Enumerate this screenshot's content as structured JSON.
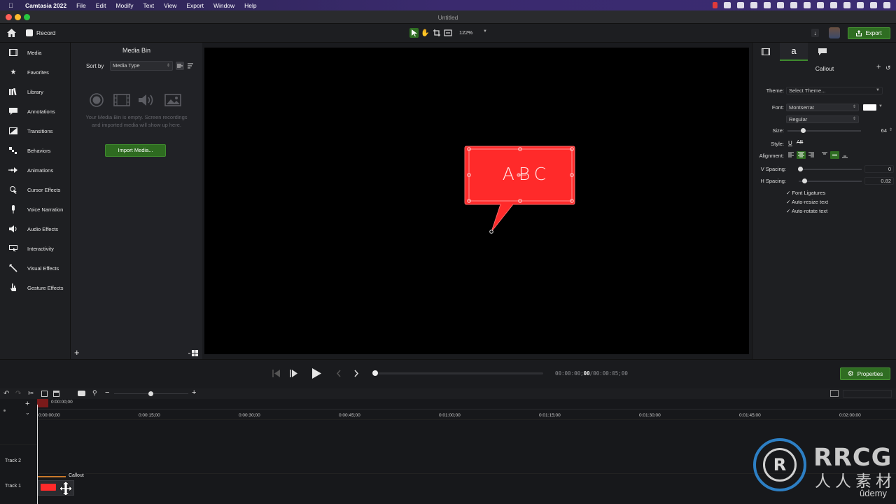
{
  "menubar": {
    "app_name": "Camtasia 2022",
    "items": [
      "File",
      "Edit",
      "Modify",
      "Text",
      "View",
      "Export",
      "Window",
      "Help"
    ]
  },
  "window": {
    "title": "Untitled"
  },
  "toolbar": {
    "record_label": "Record",
    "zoom": "122%",
    "export_label": "Export"
  },
  "sidebar": {
    "items": [
      {
        "label": "Media",
        "icon": "media-icon"
      },
      {
        "label": "Favorites",
        "icon": "star-icon"
      },
      {
        "label": "Library",
        "icon": "library-icon"
      },
      {
        "label": "Annotations",
        "icon": "annotations-icon"
      },
      {
        "label": "Transitions",
        "icon": "transitions-icon"
      },
      {
        "label": "Behaviors",
        "icon": "behaviors-icon"
      },
      {
        "label": "Animations",
        "icon": "animations-icon"
      },
      {
        "label": "Cursor Effects",
        "icon": "cursor-icon"
      },
      {
        "label": "Voice Narration",
        "icon": "microphone-icon"
      },
      {
        "label": "Audio Effects",
        "icon": "speaker-icon"
      },
      {
        "label": "Interactivity",
        "icon": "interactivity-icon"
      },
      {
        "label": "Visual Effects",
        "icon": "wand-icon"
      },
      {
        "label": "Gesture Effects",
        "icon": "hand-icon"
      }
    ]
  },
  "media_bin": {
    "title": "Media Bin",
    "sort_label": "Sort by",
    "sort_value": "Media Type",
    "empty_text": "Your Media Bin is empty. Screen recordings and imported media will show up here.",
    "import_label": "Import Media..."
  },
  "canvas": {
    "callout_text": "ABC",
    "callout_color": "#ff2a2a"
  },
  "properties": {
    "panel_title": "Callout",
    "theme_label": "Theme:",
    "theme_value": "Select Theme...",
    "font_label": "Font:",
    "font_value": "Montserrat",
    "weight_value": "Regular",
    "size_label": "Size:",
    "size_value": "64",
    "style_label": "Style:",
    "alignment_label": "Alignment:",
    "vspacing_label": "V Spacing:",
    "vspacing_value": "0",
    "hspacing_label": "H Spacing:",
    "hspacing_value": "0.82",
    "checks": [
      "Font Ligatures",
      "Auto-resize text",
      "Auto-rotate text"
    ],
    "button_label": "Properties"
  },
  "playback": {
    "time_elapsed": "00:00:00;",
    "time_frames": "00",
    "time_total": "/00:00:05;00"
  },
  "timeline": {
    "playhead_time": "0:00:00;00",
    "ticks": [
      "0:00:00;00",
      "0:00:15;00",
      "0:00:30;00",
      "0:00:45;00",
      "0:01:00;00",
      "0:01:15;00",
      "0:01:30;00",
      "0:01:45;00",
      "0:02:00;00"
    ],
    "tracks": [
      "Track 2",
      "Track 1"
    ],
    "clip_label": "Callout"
  },
  "watermark": {
    "brand": "RRCG",
    "subtitle": "人人素材",
    "udemy": "ûdemy"
  }
}
